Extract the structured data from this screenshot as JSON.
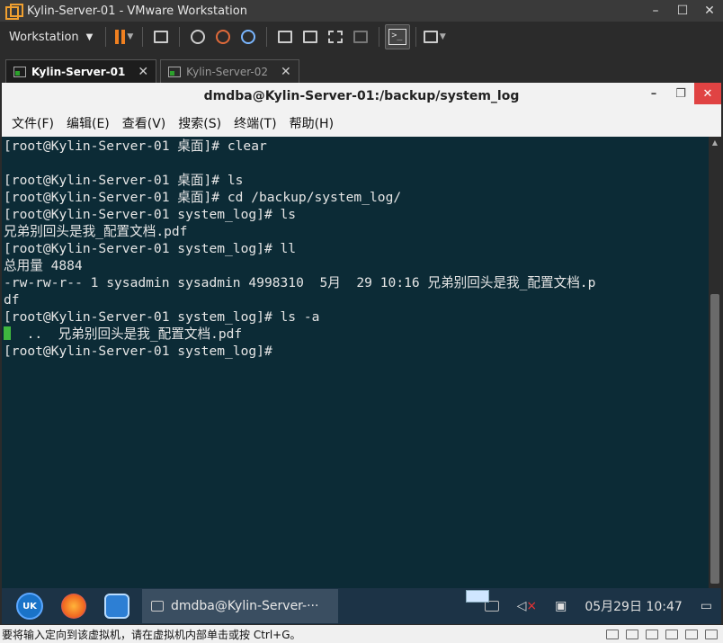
{
  "vmware": {
    "title": "Kylin-Server-01 - VMware Workstation",
    "minimize": "–",
    "maximize": "☐",
    "close": "✕",
    "workstation_menu": "Workstation",
    "tabs": [
      {
        "label": "Kylin-Server-01",
        "close": "✕"
      },
      {
        "label": "Kylin-Server-02",
        "close": "✕"
      }
    ],
    "status_text": "要将输入定向到该虚拟机，请在虚拟机内部单击或按 Ctrl+G。"
  },
  "terminal": {
    "title": "dmdba@Kylin-Server-01:/backup/system_log",
    "win_minimize": "–",
    "win_maximize": "❐",
    "win_close": "✕",
    "menu": [
      "文件(F)",
      "编辑(E)",
      "查看(V)",
      "搜索(S)",
      "终端(T)",
      "帮助(H)"
    ],
    "lines": [
      "[root@Kylin-Server-01 桌面]# clear",
      "",
      "[root@Kylin-Server-01 桌面]# ls",
      "[root@Kylin-Server-01 桌面]# cd /backup/system_log/",
      "[root@Kylin-Server-01 system_log]# ls",
      "兄弟别回头是我_配置文档.pdf",
      "[root@Kylin-Server-01 system_log]# ll",
      "总用量 4884",
      "-rw-rw-r-- 1 sysadmin sysadmin 4998310  5月  29 10:16 兄弟别回头是我_配置文档.p",
      "df",
      "[root@Kylin-Server-01 system_log]# ls -a"
    ],
    "ls_a_output": "  ..  兄弟别回头是我_配置文档.pdf",
    "last_prompt": "[root@Kylin-Server-01 system_log]# "
  },
  "taskbar": {
    "start_label": "UK",
    "window_label": "dmdba@Kylin-Server-···",
    "datetime": "05月29日 10:47"
  },
  "colors": {
    "terminal_bg": "#0c2b36",
    "terminal_fg": "#e6e6e6",
    "cursor": "#3fb83f",
    "taskbar_bg": "#1c3346",
    "close_red": "#e04343"
  }
}
